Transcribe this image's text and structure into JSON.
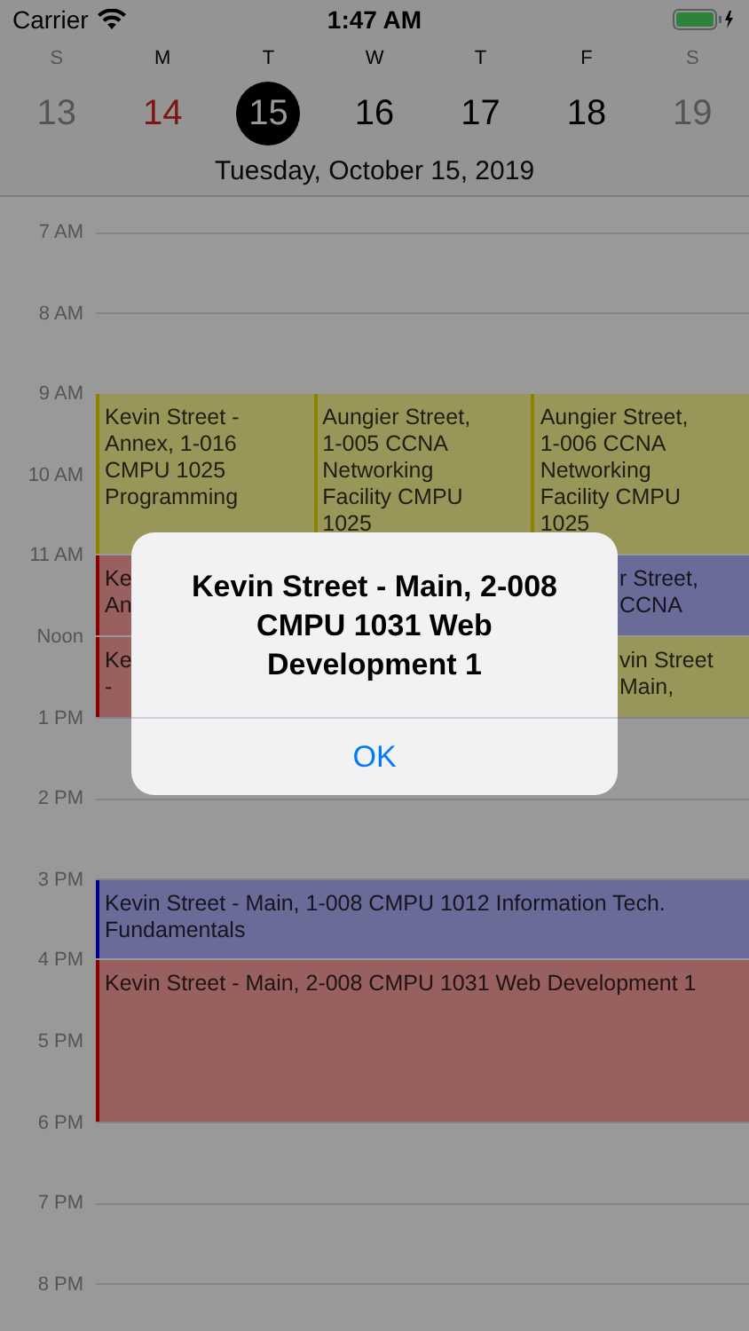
{
  "status_bar": {
    "carrier": "Carrier",
    "time": "1:47 AM"
  },
  "week": [
    {
      "letter": "S",
      "number": "13",
      "kind": "weekend",
      "selected": false
    },
    {
      "letter": "M",
      "number": "14",
      "kind": "today",
      "selected": false
    },
    {
      "letter": "T",
      "number": "15",
      "kind": "weekday",
      "selected": true
    },
    {
      "letter": "W",
      "number": "16",
      "kind": "weekday",
      "selected": false
    },
    {
      "letter": "T",
      "number": "17",
      "kind": "weekday",
      "selected": false
    },
    {
      "letter": "F",
      "number": "18",
      "kind": "weekday",
      "selected": false
    },
    {
      "letter": "S",
      "number": "19",
      "kind": "weekend",
      "selected": false
    }
  ],
  "date_title": "Tuesday, October 15, 2019",
  "hours": [
    {
      "label": "7 AM"
    },
    {
      "label": "8 AM"
    },
    {
      "label": "9 AM",
      "events": [
        {
          "kind": "left",
          "long": true,
          "covered": false,
          "color": "#99965a",
          "lines": [
            "Kevin Street -",
            "Annex, 1-016",
            "CMPU 1025",
            "Programming"
          ]
        },
        {
          "kind": "middle",
          "long": true,
          "covered": false,
          "color": "#99965a",
          "lines": [
            "Aungier Street,",
            "1-005 CCNA",
            "Networking",
            "Facility CMPU",
            "1025"
          ]
        },
        {
          "kind": "right",
          "long": true,
          "covered": false,
          "color": "#99965a",
          "lines": [
            "Aungier Street,",
            "1-006 CCNA",
            "Networking",
            "Facility CMPU",
            "1025"
          ]
        }
      ]
    },
    {
      "label": "10 AM"
    },
    {
      "label": "11 AM",
      "events": [
        {
          "kind": "left",
          "long": false,
          "covered": true,
          "color": "#996060",
          "lines": [
            "Ke",
            "An"
          ]
        },
        {
          "kind": "right",
          "long": false,
          "covered": true,
          "color": "#6b6b99",
          "lines": [
            "r Street,",
            "CCNA"
          ]
        }
      ]
    },
    {
      "label": "Noon",
      "events": [
        {
          "kind": "left",
          "long": false,
          "covered": true,
          "color": "#996060",
          "lines": [
            "Ke",
            "-"
          ]
        },
        {
          "kind": "right",
          "long": false,
          "covered": true,
          "color": "#99965a",
          "lines": [
            "vin Street",
            "Main,"
          ]
        }
      ]
    },
    {
      "label": "1 PM"
    },
    {
      "label": "2 PM"
    },
    {
      "label": "3 PM",
      "events": [
        {
          "kind": "full",
          "long": false,
          "covered": false,
          "color": "#6b6b99",
          "lines": [
            "Kevin Street - Main, 1-008 CMPU 1012 Information Tech. Fundamentals"
          ]
        }
      ]
    },
    {
      "label": "4 PM",
      "events": [
        {
          "kind": "full",
          "long": true,
          "covered": false,
          "color": "#996060",
          "lines": [
            "Kevin Street - Main, 2-008 CMPU 1031 Web Development 1"
          ]
        }
      ]
    },
    {
      "label": "5 PM"
    },
    {
      "label": "6 PM"
    },
    {
      "label": "7 PM"
    },
    {
      "label": "8 PM"
    }
  ],
  "alert": {
    "title": "Kevin Street - Main, 2-008 CMPU 1031 Web Development 1",
    "button": "OK"
  }
}
